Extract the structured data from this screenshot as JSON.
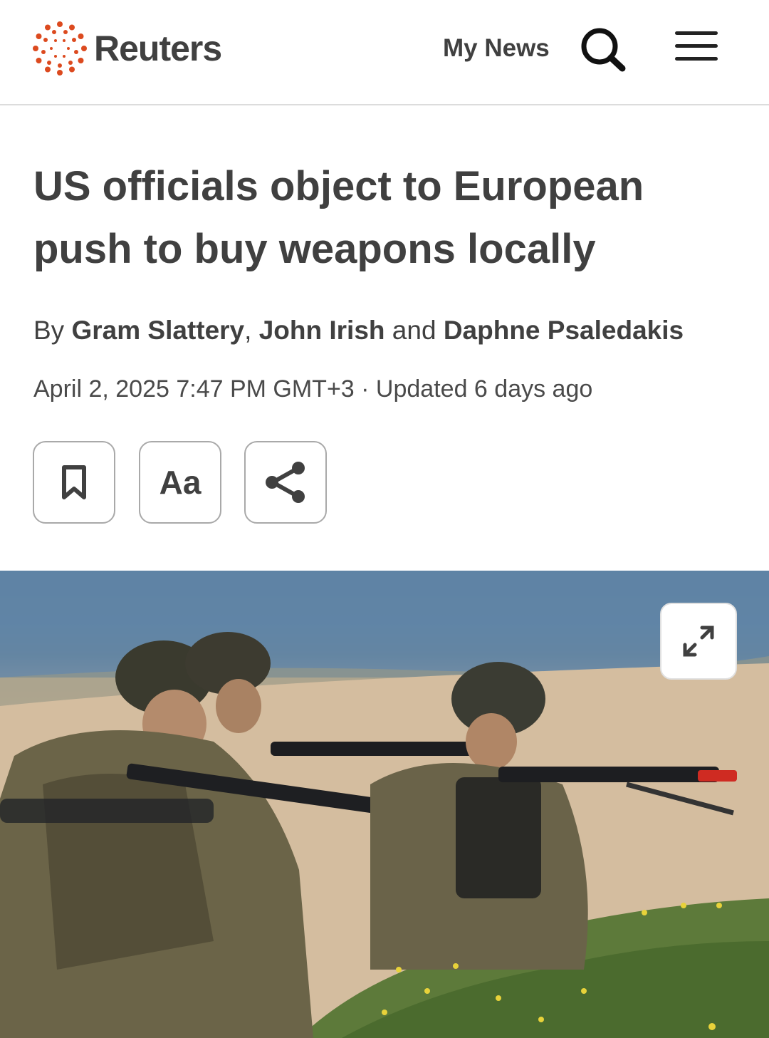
{
  "header": {
    "brand": "Reuters",
    "my_news_label": "My News",
    "search_icon": "search-icon",
    "menu_icon": "hamburger-menu-icon"
  },
  "article": {
    "headline": "US officials object to European push to buy weapons locally",
    "byline": {
      "prefix": "By",
      "authors": [
        "Gram Slattery",
        "John Irish",
        "Daphne Psaledakis"
      ],
      "separator": ",",
      "conjunction": "and"
    },
    "dateline": "April 2, 2025 7:47 PM GMT+3 · Updated 6 days ago",
    "tools": {
      "bookmark_icon": "bookmark-icon",
      "text_size_label": "Aa",
      "share_icon": "share-icon"
    },
    "hero_image": {
      "expand_icon": "expand-icon"
    }
  },
  "colors": {
    "text": "#404040",
    "logo_accent": "#dc4a1f",
    "border": "#a9a9a9"
  }
}
